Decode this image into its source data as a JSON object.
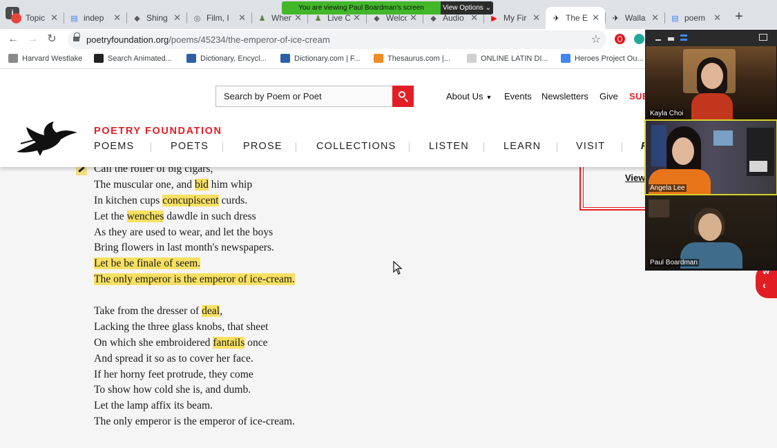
{
  "browser": {
    "tabs": [
      {
        "label": "Topic",
        "icon": "meet-icon"
      },
      {
        "label": "indep",
        "icon": "docs-icon"
      },
      {
        "label": "Shing",
        "icon": "page-icon"
      },
      {
        "label": "Film, I",
        "icon": "globe-icon"
      },
      {
        "label": "When",
        "icon": "person-icon"
      },
      {
        "label": "Live C",
        "icon": "person-icon"
      },
      {
        "label": "Welco",
        "icon": "page-icon"
      },
      {
        "label": "Audio",
        "icon": "page-icon"
      },
      {
        "label": "My Fir",
        "icon": "youtube-icon"
      },
      {
        "label": "The E",
        "icon": "poetry-bird-icon",
        "active": true
      },
      {
        "label": "Walla",
        "icon": "poetry-bird-icon"
      },
      {
        "label": "poem",
        "icon": "docs-icon"
      }
    ],
    "share_banner": {
      "message": "You are viewing Paul Boardman's screen",
      "options_label": "View Options"
    },
    "url": {
      "domain": "poetryfoundation.org",
      "path": "/poems/45234/the-emperor-of-ice-cream"
    },
    "bookmarks": [
      {
        "label": "Harvard Westlake",
        "color": "#8a8a8a"
      },
      {
        "label": "Search Animated...",
        "color": "#222222"
      },
      {
        "label": "Dictionary, Encycl...",
        "color": "#2c5fa8"
      },
      {
        "label": "Dictionary.com | F...",
        "color": "#2c5fa8"
      },
      {
        "label": "Thesaurus.com |...",
        "color": "#f08c28"
      },
      {
        "label": "ONLINE LATIN DI...",
        "color": "#cfcfcf"
      },
      {
        "label": "Heroes Project Ou...",
        "color": "#4285f4"
      }
    ]
  },
  "site": {
    "search_placeholder": "Search by Poem or Poet",
    "top_nav": [
      "About Us",
      "Events",
      "Newsletters",
      "Give",
      "SUB"
    ],
    "brand": "POETRY FOUNDATION",
    "main_nav": [
      "POEMS",
      "POETS",
      "PROSE",
      "COLLECTIONS",
      "LISTEN",
      "LEARN",
      "VISIT",
      "F"
    ],
    "side_link": "View"
  },
  "poem": {
    "stanza1": [
      [
        {
          "t": "Call the roller of big cigars,"
        }
      ],
      [
        {
          "t": "The muscular one, and "
        },
        {
          "t": "bid",
          "hl": true
        },
        {
          "t": " him whip"
        }
      ],
      [
        {
          "t": "In kitchen cups "
        },
        {
          "t": "concupiscent",
          "hl": true
        },
        {
          "t": " curds."
        }
      ],
      [
        {
          "t": "Let the "
        },
        {
          "t": "wenches",
          "hl": true
        },
        {
          "t": " dawdle in such dress"
        }
      ],
      [
        {
          "t": "As they are used to wear, and let the boys"
        }
      ],
      [
        {
          "t": "Bring flowers in last month's newspapers."
        }
      ],
      [
        {
          "t": "Let be be finale of seem.",
          "hl": true
        }
      ],
      [
        {
          "t": "The only emperor is the emperor of ice-cream.",
          "hl": true
        }
      ]
    ],
    "stanza2": [
      [
        {
          "t": "Take from the dresser of "
        },
        {
          "t": "deal",
          "hl": true
        },
        {
          "t": ","
        }
      ],
      [
        {
          "t": "Lacking the three glass knobs, that sheet"
        }
      ],
      [
        {
          "t": "On which she embroidered "
        },
        {
          "t": "fantails",
          "hl": true
        },
        {
          "t": " once"
        }
      ],
      [
        {
          "t": "And spread it so as to cover her face."
        }
      ],
      [
        {
          "t": "If her horny feet protrude, they come"
        }
      ],
      [
        {
          "t": "To show how cold she is, and dumb."
        }
      ],
      [
        {
          "t": "Let the lamp affix its beam."
        }
      ],
      [
        {
          "t": "The only emperor is the emperor of ice-cream."
        }
      ]
    ]
  },
  "video": {
    "participants": [
      {
        "name": "Kayla Choi"
      },
      {
        "name": "Angela Lee",
        "active_speaker": true
      },
      {
        "name": "Paul Boardman"
      }
    ]
  },
  "side_tab_letter": "W",
  "colors": {
    "brand_red": "#e21e25",
    "highlight": "#f8e061",
    "share_green": "#42b72a",
    "speaker_outline": "#d8d32a"
  }
}
